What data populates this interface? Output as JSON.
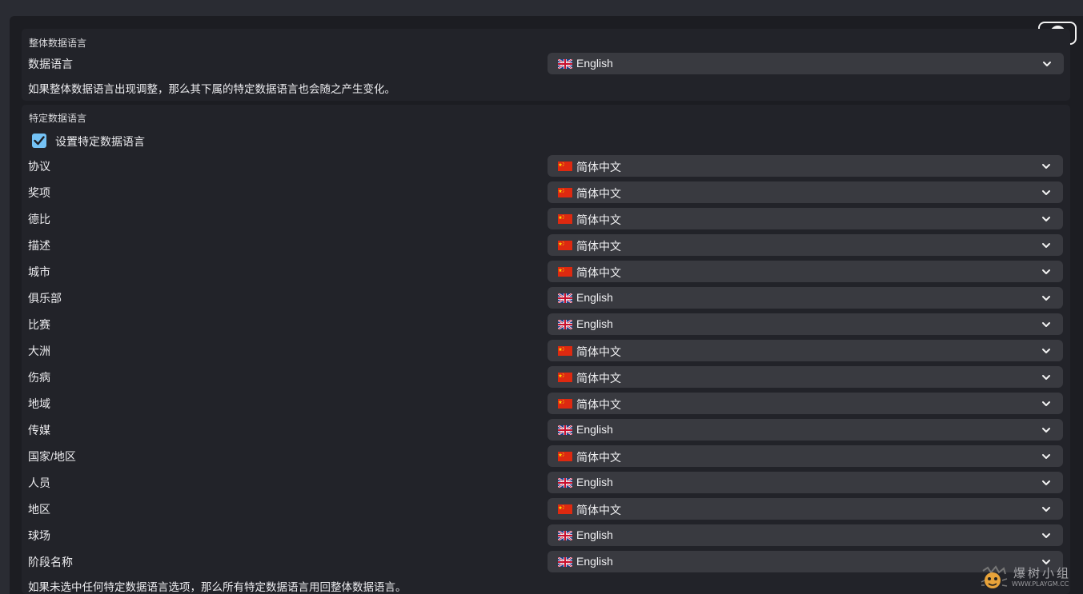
{
  "overall": {
    "section_title": "整体数据语言",
    "row_label": "数据语言",
    "value": {
      "text": "English",
      "flag": "uk-flag-icon"
    },
    "hint": "如果整体数据语言出现调整，那么其下属的特定数据语言也会随之产生变化。"
  },
  "specific": {
    "section_title": "特定数据语言",
    "checkbox_label": "设置特定数据语言",
    "checkbox_checked": true,
    "rows": [
      {
        "label": "协议",
        "value": "简体中文",
        "flag": "cn"
      },
      {
        "label": "奖项",
        "value": "简体中文",
        "flag": "cn"
      },
      {
        "label": "德比",
        "value": "简体中文",
        "flag": "cn"
      },
      {
        "label": "描述",
        "value": "简体中文",
        "flag": "cn"
      },
      {
        "label": "城市",
        "value": "简体中文",
        "flag": "cn"
      },
      {
        "label": "俱乐部",
        "value": "English",
        "flag": "uk"
      },
      {
        "label": "比赛",
        "value": "English",
        "flag": "uk"
      },
      {
        "label": "大洲",
        "value": "简体中文",
        "flag": "cn"
      },
      {
        "label": "伤病",
        "value": "简体中文",
        "flag": "cn"
      },
      {
        "label": "地域",
        "value": "简体中文",
        "flag": "cn"
      },
      {
        "label": "传媒",
        "value": "English",
        "flag": "uk"
      },
      {
        "label": "国家/地区",
        "value": "简体中文",
        "flag": "cn"
      },
      {
        "label": "人员",
        "value": "English",
        "flag": "uk"
      },
      {
        "label": "地区",
        "value": "简体中文",
        "flag": "cn"
      },
      {
        "label": "球场",
        "value": "English",
        "flag": "uk"
      },
      {
        "label": "阶段名称",
        "value": "English",
        "flag": "uk"
      }
    ],
    "hint": "如果未选中任何特定数据语言选项，那么所有特定数据语言用回整体数据语言。"
  },
  "icons": {
    "close": "close-icon",
    "dropdown": "chevron-down-icon",
    "check": "checkmark-icon",
    "uk": "uk-flag-icon",
    "cn": "china-flag-icon"
  },
  "colors": {
    "background": "#1c1d22",
    "panel": "#222329",
    "select": "#393a40",
    "checkbox_accent": "#74c2f5"
  },
  "watermark": {
    "text": "爆树小组",
    "url": "WWW.PLAYGM.CC"
  }
}
